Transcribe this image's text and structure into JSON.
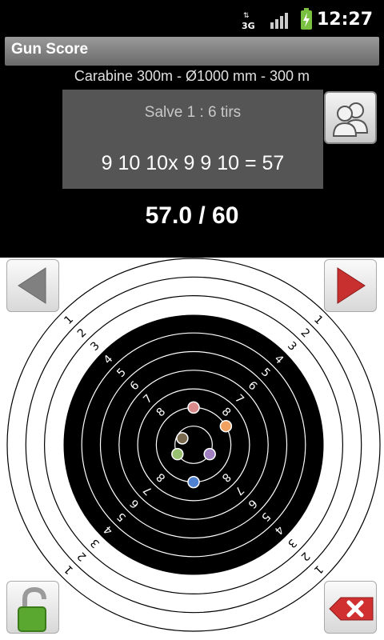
{
  "status": {
    "network": "3G",
    "time": "12:27"
  },
  "app": {
    "title": "Gun Score"
  },
  "session": {
    "discipline": "Carabine 300m - Ø1000 mm - 300 m",
    "salve_title": "Salve 1 : 6 tirs",
    "salve_detail": "9 10 10x 9 9 10 = 57",
    "total": "57.0 / 60"
  },
  "target": {
    "ring_labels": [
      "1",
      "2",
      "3",
      "4",
      "5",
      "6",
      "7",
      "8"
    ],
    "shots": [
      {
        "ring": "9",
        "color": "#d98a8a"
      },
      {
        "ring": "9",
        "color": "#f0a060"
      },
      {
        "ring": "10",
        "color": "#a080c0"
      },
      {
        "ring": "9",
        "color": "#5080d0"
      },
      {
        "ring": "10",
        "color": "#98c070"
      },
      {
        "ring": "10x",
        "color": "#7a6a50"
      }
    ]
  },
  "icons": {
    "prev": "arrow-left-icon",
    "next": "arrow-right-icon",
    "users": "users-icon",
    "lock": "unlock-icon",
    "delete": "delete-icon",
    "network": "network-3g-icon",
    "signal": "signal-icon",
    "battery": "battery-charging-icon"
  },
  "colors": {
    "next_arrow": "#c83030",
    "prev_arrow": "#808080",
    "lock": "#5aa830",
    "delete": "#d03030"
  }
}
